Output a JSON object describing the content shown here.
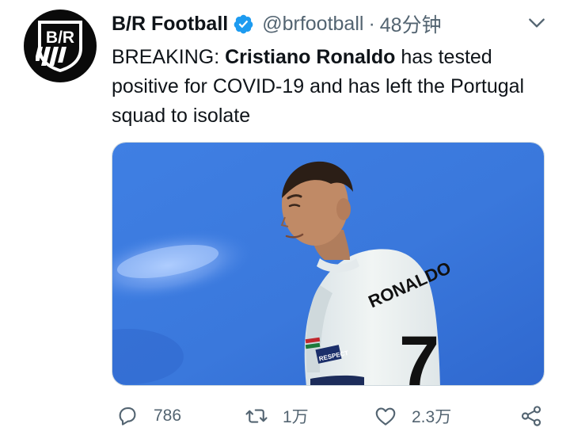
{
  "tweet": {
    "author": {
      "display_name": "B/R Football",
      "handle": "@brfootball",
      "avatar_text": "B/R",
      "verified": true
    },
    "separator": "·",
    "time": "48分钟",
    "text_parts": {
      "prefix": "BREAKING: ",
      "bold": "Cristiano Ronaldo",
      "suffix": " has tested positive for COVID-19 and has left the Portugal squad to isolate"
    },
    "media": {
      "jersey_name": "RONALDO",
      "jersey_number": "7",
      "sleeve_badge": "RESPECT"
    },
    "actions": {
      "reply_count": "786",
      "retweet_count": "1万",
      "like_count": "2.3万"
    }
  },
  "colors": {
    "text": "#0f1419",
    "muted": "#536471",
    "verified": "#1d9bf0",
    "photo_blue": "#3d7fe0"
  },
  "icons": [
    "verified-badge-icon",
    "chevron-down-icon",
    "reply-icon",
    "retweet-icon",
    "like-icon",
    "share-icon"
  ]
}
